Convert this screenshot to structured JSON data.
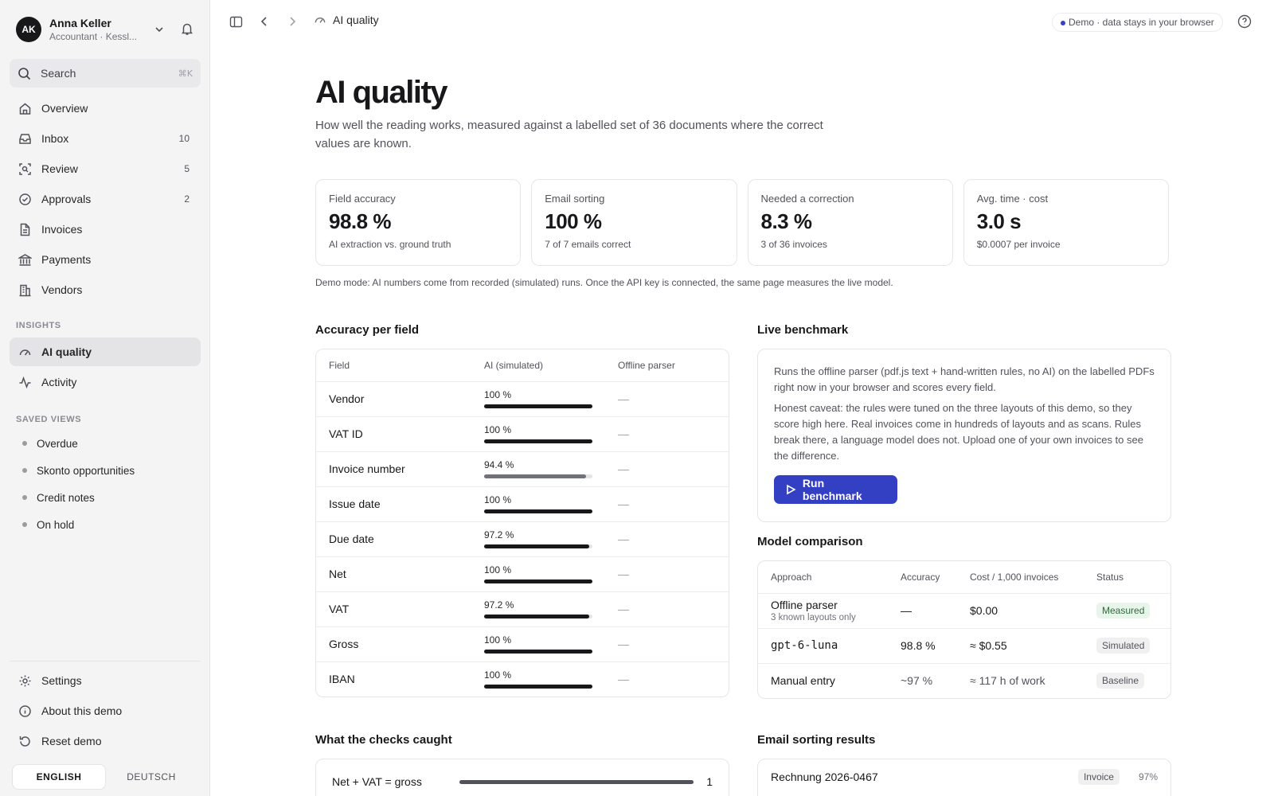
{
  "user": {
    "initials": "AK",
    "name": "Anna Keller",
    "role": "Accountant · Kessl..."
  },
  "search": {
    "placeholder": "Search",
    "shortcut": "⌘K"
  },
  "nav": [
    {
      "label": "Overview",
      "count": ""
    },
    {
      "label": "Inbox",
      "count": "10"
    },
    {
      "label": "Review",
      "count": "5"
    },
    {
      "label": "Approvals",
      "count": "2"
    },
    {
      "label": "Invoices",
      "count": ""
    },
    {
      "label": "Payments",
      "count": ""
    },
    {
      "label": "Vendors",
      "count": ""
    }
  ],
  "insights": {
    "title": "INSIGHTS",
    "items": [
      {
        "label": "AI quality"
      },
      {
        "label": "Activity"
      }
    ]
  },
  "saved_views": {
    "title": "SAVED VIEWS",
    "items": [
      "Overdue",
      "Skonto opportunities",
      "Credit notes",
      "On hold"
    ]
  },
  "footer": {
    "settings": "Settings",
    "about": "About this demo",
    "reset": "Reset demo"
  },
  "lang": {
    "en": "ENGLISH",
    "de": "DEUTSCH"
  },
  "topbar": {
    "crumb": "AI quality",
    "demo": "Demo · data stays in your browser"
  },
  "page": {
    "title": "AI quality",
    "subtitle": "How well the reading works, measured against a labelled set of 36 documents where the correct values are known."
  },
  "kpis": [
    {
      "title": "Field accuracy",
      "value": "98.8 %",
      "sub": "AI extraction vs. ground truth"
    },
    {
      "title": "Email sorting",
      "value": "100 %",
      "sub": "7 of 7 emails correct"
    },
    {
      "title": "Needed a correction",
      "value": "8.3 %",
      "sub": "3 of 36 invoices"
    },
    {
      "title": "Avg. time · cost",
      "value": "3.0 s",
      "sub": "$0.0007 per invoice"
    }
  ],
  "note": "Demo mode: AI numbers come from recorded (simulated) runs. Once the API key is connected, the same page measures the live model.",
  "accuracy": {
    "title": "Accuracy per field",
    "headers": [
      "Field",
      "AI (simulated)",
      "Offline parser"
    ],
    "rows": [
      {
        "field": "Vendor",
        "ai": "100 %",
        "pct": 100,
        "offline": "—"
      },
      {
        "field": "VAT ID",
        "ai": "100 %",
        "pct": 100,
        "offline": "—"
      },
      {
        "field": "Invoice number",
        "ai": "94.4 %",
        "pct": 94.4,
        "offline": "—"
      },
      {
        "field": "Issue date",
        "ai": "100 %",
        "pct": 100,
        "offline": "—"
      },
      {
        "field": "Due date",
        "ai": "97.2 %",
        "pct": 97.2,
        "offline": "—"
      },
      {
        "field": "Net",
        "ai": "100 %",
        "pct": 100,
        "offline": "—"
      },
      {
        "field": "VAT",
        "ai": "97.2 %",
        "pct": 97.2,
        "offline": "—"
      },
      {
        "field": "Gross",
        "ai": "100 %",
        "pct": 100,
        "offline": "—"
      },
      {
        "field": "IBAN",
        "ai": "100 %",
        "pct": 100,
        "offline": "—"
      }
    ]
  },
  "benchmark": {
    "title": "Live benchmark",
    "p1": "Runs the offline parser (pdf.js text + hand-written rules, no AI) on the labelled PDFs right now in your browser and scores every field.",
    "p2": "Honest caveat: the rules were tuned on the three layouts of this demo, so they score high here. Real invoices come in hundreds of layouts and as scans. Rules break there, a language model does not. Upload one of your own invoices to see the difference.",
    "button": "Run benchmark"
  },
  "comparison": {
    "title": "Model comparison",
    "headers": [
      "Approach",
      "Accuracy",
      "Cost / 1,000 invoices",
      "Status"
    ],
    "rows": [
      {
        "name": "Offline parser",
        "meta": "3 known layouts only",
        "accuracy": "—",
        "cost": "$0.00",
        "status": "Measured"
      },
      {
        "name": "gpt-6-luna",
        "meta": "",
        "accuracy": "98.8 %",
        "cost": "≈ $0.55",
        "status": "Simulated"
      },
      {
        "name": "Manual entry",
        "meta": "",
        "accuracy": "~97 %",
        "cost": "≈ 117 h of work",
        "status": "Baseline"
      }
    ]
  },
  "checks": {
    "title": "What the checks caught",
    "rows": [
      {
        "label": "Net + VAT = gross",
        "count": "1",
        "frac": 1
      }
    ]
  },
  "email": {
    "title": "Email sorting results",
    "rows": [
      {
        "name": "Rechnung 2026-0467",
        "tag": "Invoice",
        "pct": "97%"
      }
    ]
  },
  "colors": {
    "accent": "#3440c4",
    "bar": "#18181b",
    "measured": "#2d6b3c"
  }
}
